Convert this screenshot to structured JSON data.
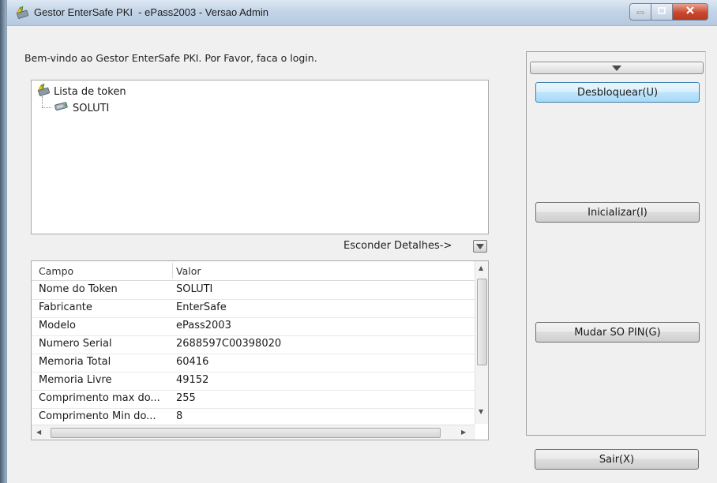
{
  "window": {
    "title": "Gestor EnterSafe PKI  - ePass2003 - Versao Admin",
    "app_icon": "token-manager-icon",
    "controls": {
      "minimize_icon": "minimize-icon",
      "maximize_icon": "maximize-icon",
      "close_icon": "close-icon"
    }
  },
  "welcome_text": "Bem-vindo ao Gestor EnterSafe PKI. Por Favor, faca o login.",
  "tree": {
    "root_label": "Lista de token",
    "root_icon": "token-list-icon",
    "children": [
      {
        "label": "SOLUTI",
        "icon": "token-icon"
      }
    ]
  },
  "details_toggle": {
    "label": "Esconder Detalhes->",
    "icon": "collapse-down-icon"
  },
  "details_grid": {
    "columns": [
      "Campo",
      "Valor"
    ],
    "rows": [
      {
        "campo": "Nome do Token",
        "valor": "SOLUTI"
      },
      {
        "campo": "Fabricante",
        "valor": "EnterSafe"
      },
      {
        "campo": "Modelo",
        "valor": "ePass2003"
      },
      {
        "campo": "Numero Serial",
        "valor": "2688597C00398020"
      },
      {
        "campo": "Memoria Total",
        "valor": "60416"
      },
      {
        "campo": "Memoria Livre",
        "valor": "49152"
      },
      {
        "campo": "Comprimento max do...",
        "valor": "255"
      },
      {
        "campo": "Comprimento Min do...",
        "valor": "8"
      }
    ]
  },
  "actions": {
    "collapse_icon": "chevron-down-icon",
    "unlock": "Desbloquear(U)",
    "initialize": "Inicializar(I)",
    "change_so_pin": "Mudar SO PIN(G)",
    "exit": "Sair(X)"
  },
  "colors": {
    "hot_button": "#bee6fd",
    "close_button": "#c9472d",
    "titlebar": "#c3d4e7"
  }
}
